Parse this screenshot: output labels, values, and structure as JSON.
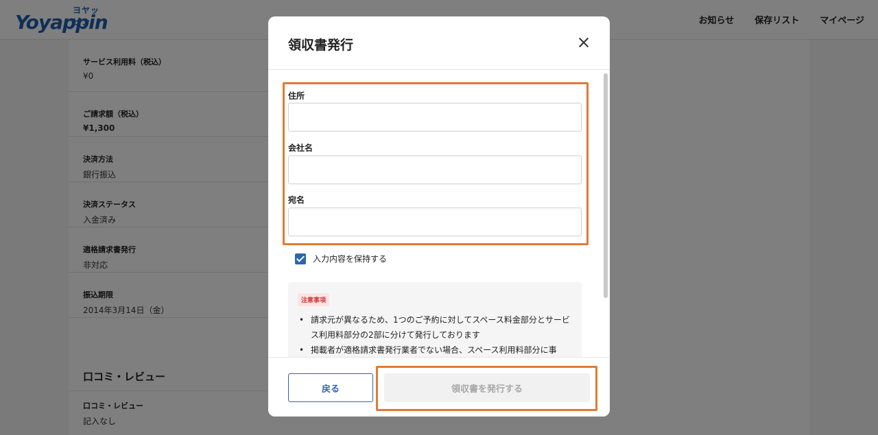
{
  "header": {
    "logo_kana": "ヨヤッピン",
    "logo_word": "Yoyappin",
    "nav": [
      "お知らせ",
      "保存リスト",
      "マイページ"
    ]
  },
  "details": [
    {
      "label": "サービス利用料（税込）",
      "value": "¥0"
    },
    {
      "label": "ご請求額（税込）",
      "value": "¥1,300"
    },
    {
      "label": "決済方法",
      "value": "銀行振込"
    },
    {
      "label": "決済ステータス",
      "value": "入金済み"
    },
    {
      "label": "適格請求書発行",
      "value": "非対応"
    },
    {
      "label": "振込期限",
      "value": "2014年3月14日（金）"
    }
  ],
  "review": {
    "section_title": "口コミ・レビュー",
    "label": "口コミ・レビュー",
    "value": "記入なし"
  },
  "modal": {
    "title": "領収書発行",
    "fields": {
      "address_label": "住所",
      "address_value": "",
      "company_label": "会社名",
      "company_value": "",
      "recipient_label": "宛名",
      "recipient_value": ""
    },
    "keep_input_label": "入力内容を保持する",
    "keep_input_checked": true,
    "notice": {
      "badge": "注意事項",
      "items": [
        "請求元が異なるため、1つのご予約に対してスペース料金部分とサービス利用料部分の2部に分けて発行しております",
        "掲載者が適格請求書発行業者でない場合、スペース利用料部分に事"
      ]
    },
    "back_label": "戻る",
    "issue_label": "領収書を発行する"
  },
  "colors": {
    "brand": "#1f5fb0",
    "primary": "#2a66b3",
    "highlight": "#e07a33",
    "notice_badge": "#d23a3a"
  }
}
